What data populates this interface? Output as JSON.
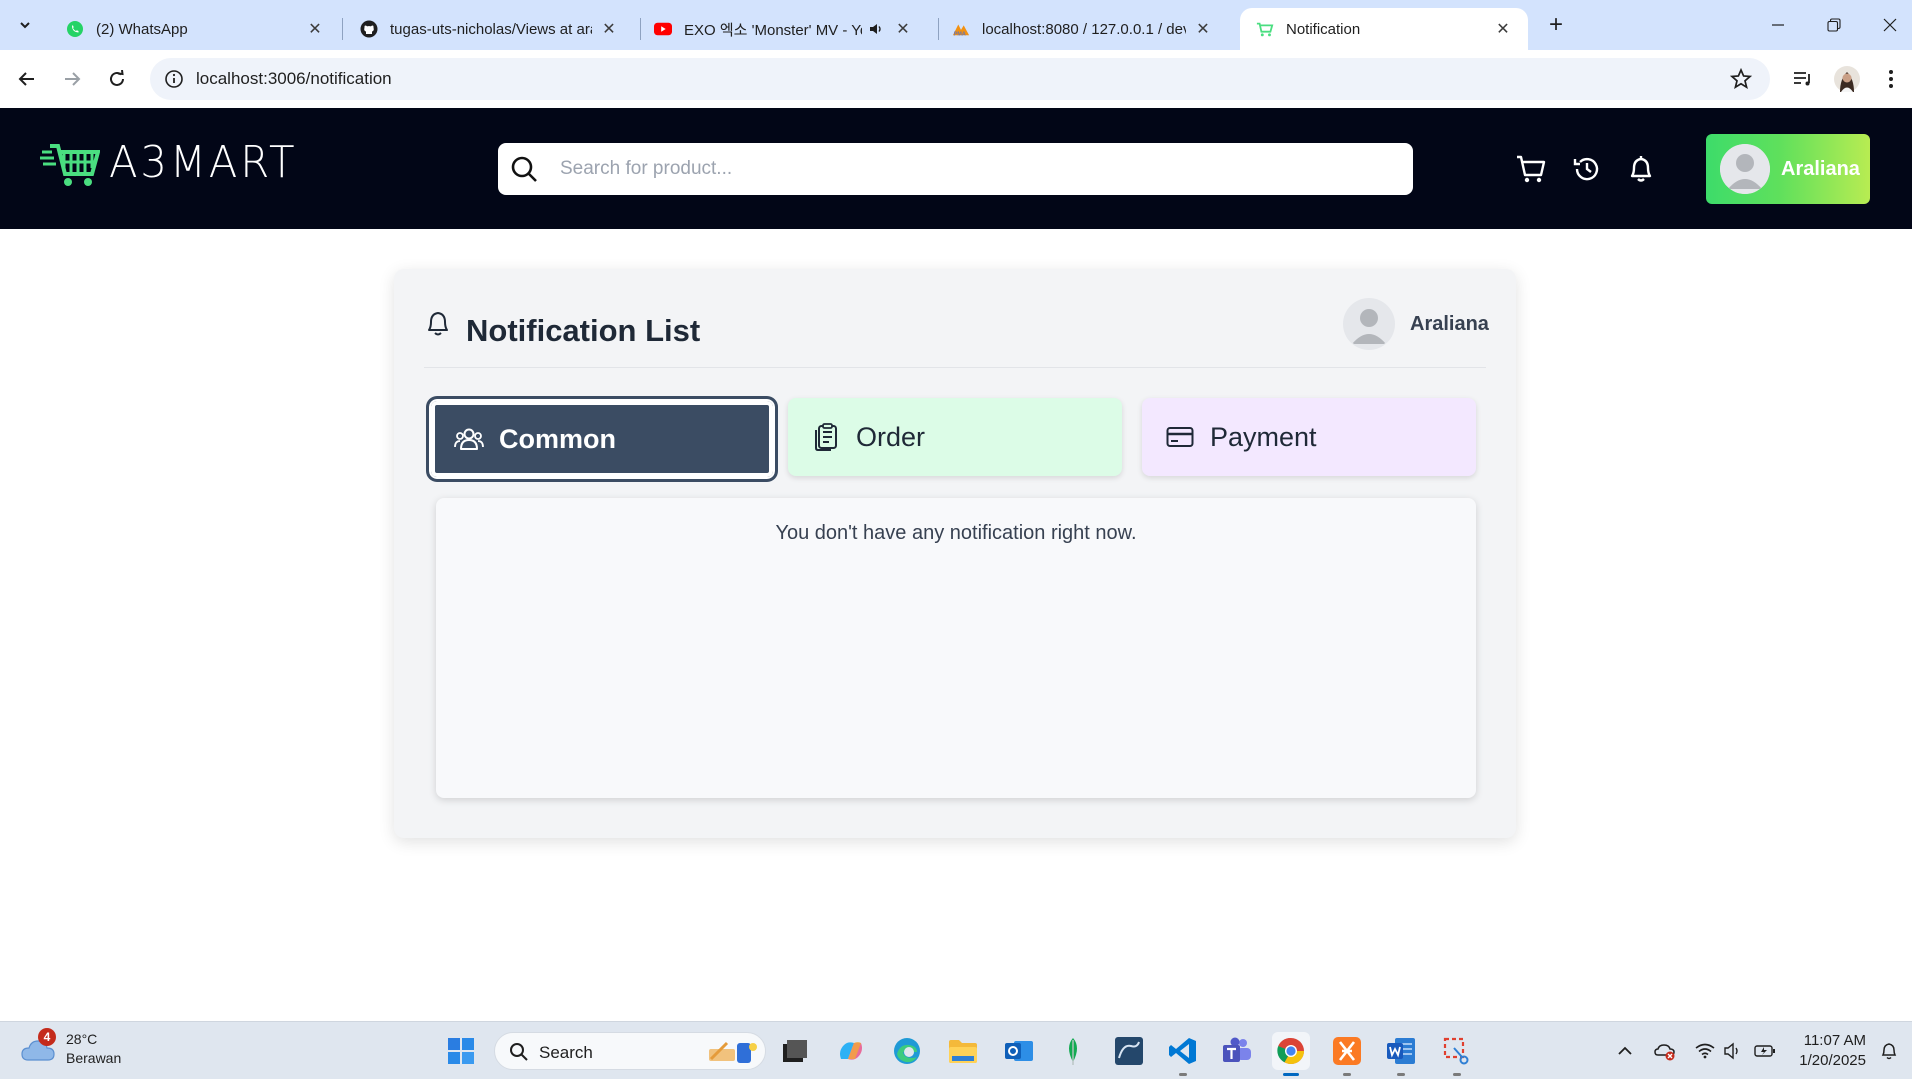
{
  "browser": {
    "tabs": [
      {
        "title": "(2) WhatsApp",
        "icon": "whatsapp-icon"
      },
      {
        "title": "tugas-uts-nicholas/Views at ara",
        "icon": "github-icon"
      },
      {
        "title": "EXO 엑소 'Monster' MV - Yo",
        "icon": "youtube-icon"
      },
      {
        "title": "localhost:8080 / 127.0.0.1 / dev",
        "icon": "phpmyadmin-icon"
      },
      {
        "title": "Notification",
        "icon": "cart-favicon-icon"
      }
    ],
    "url": "localhost:3006/notification"
  },
  "header": {
    "logo_text": "A3MART",
    "search_placeholder": "Search for product...",
    "user_name": "Araliana"
  },
  "notifications": {
    "title": "Notification List",
    "user_name": "Araliana",
    "tabs": [
      {
        "label": "Common",
        "icon": "users-icon"
      },
      {
        "label": "Order",
        "icon": "clipboard-icon"
      },
      {
        "label": "Payment",
        "icon": "credit-card-icon"
      }
    ],
    "empty_message": "You don't have any notification right now."
  },
  "taskbar": {
    "weather_temp": "28°C",
    "weather_desc": "Berawan",
    "weather_badge": "4",
    "search_label": "Search",
    "time": "11:07 AM",
    "date": "1/20/2025"
  },
  "colors": {
    "header_bg": "#020617",
    "accent_green": "#4ade80",
    "common_tab": "#3b4c63",
    "order_tab": "#dcfce7",
    "payment_tab": "#f3e8ff"
  }
}
